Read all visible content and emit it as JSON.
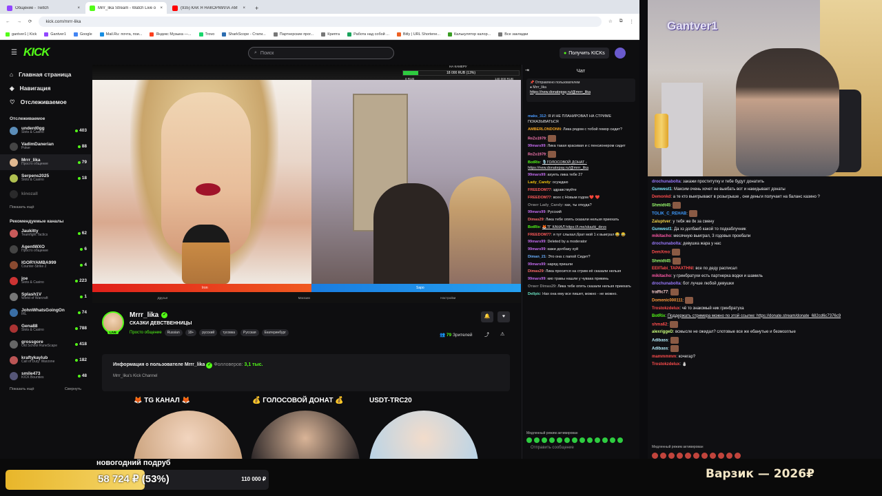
{
  "tabs": [
    {
      "title": "Общение - Twitch",
      "color": "#9146ff"
    },
    {
      "title": "Mrrr_lika Stream - Watch Live o",
      "color": "#53fc18"
    },
    {
      "title": "(935) КАК Я НАКОРМИЛА АМ",
      "color": "#ff0000"
    }
  ],
  "url": "kick.com/mrrr-lika",
  "bookmarks": [
    {
      "label": "gantver1 | Kick",
      "color": "#53fc18"
    },
    {
      "label": "Gantver1",
      "color": "#9146ff"
    },
    {
      "label": "Google",
      "color": "#4285f4"
    },
    {
      "label": "Mail.Ru: почта, пои...",
      "color": "#168de2"
    },
    {
      "label": "Яндекс Музыка —...",
      "color": "#fc3f1d"
    },
    {
      "label": "Trovo",
      "color": "#19d66b"
    },
    {
      "label": "SharkScope - Стати...",
      "color": "#2b6cb0"
    },
    {
      "label": "Партнерские прог...",
      "color": "#777"
    },
    {
      "label": "Крипта",
      "color": "#777"
    },
    {
      "label": "Работа над собой ...",
      "color": "#19a35b"
    },
    {
      "label": "Bitly | URL Shortene...",
      "color": "#ee6123"
    },
    {
      "label": "Калькулятор калор...",
      "color": "#3a9d23"
    },
    {
      "label": "Все закладки",
      "color": "#777"
    }
  ],
  "kick": {
    "logo": "KICK",
    "search_placeholder": "Поиск",
    "get_kicks": "Получить KICKs"
  },
  "sidebar": {
    "nav": [
      {
        "label": "Главная страница",
        "icon": "home-icon"
      },
      {
        "label": "Навигация",
        "icon": "compass-icon"
      },
      {
        "label": "Отслеживаемое",
        "icon": "heart-icon"
      }
    ],
    "followed_title": "Отслеживаемое",
    "followed": [
      {
        "name": "underd0gg",
        "cat": "Slots & Casino",
        "viewers": "403",
        "color": "#5b8db8"
      },
      {
        "name": "VadimDanerian",
        "cat": "Poker",
        "viewers": "88",
        "color": "#444"
      },
      {
        "name": "Mrrr_lika",
        "cat": "Просто общение",
        "viewers": "79",
        "color": "#e0b890"
      },
      {
        "name": "Serpens2025",
        "cat": "Slots & Casino",
        "viewers": "18",
        "color": "#b0c050"
      },
      {
        "name": "kinozall",
        "cat": "",
        "viewers": "",
        "color": "#555"
      }
    ],
    "show_more": "Показать ещё",
    "recommended_title": "Рекомендуемые каналы",
    "recommended": [
      {
        "name": "Jaukitty",
        "cat": "Teamfight Tactics",
        "viewers": "62",
        "color": "#c85a5a"
      },
      {
        "name": "AgentWXO",
        "cat": "Просто общение",
        "viewers": "6",
        "color": "#444"
      },
      {
        "name": "IGORYAMBA999",
        "cat": "Counter-Strike 2",
        "viewers": "4",
        "color": "#8a4a30"
      },
      {
        "name": "joe",
        "cat": "Slots & Casino",
        "viewers": "223",
        "color": "#c33"
      },
      {
        "name": "Splash1V",
        "cat": "World of Warcraft",
        "viewers": "1",
        "color": "#777"
      },
      {
        "name": "JohnWhatsGoingOn",
        "cat": "IRL",
        "viewers": "74",
        "color": "#3a6ea5"
      },
      {
        "name": "Gena88",
        "cat": "Slots & Casino",
        "viewers": "788",
        "color": "#a33"
      },
      {
        "name": "grossgore",
        "cat": "Old School RuneScape",
        "viewers": "418",
        "color": "#666"
      },
      {
        "name": "kraftykaylub",
        "cat": "Call of Duty: Warzone",
        "viewers": "182",
        "color": "#b55"
      },
      {
        "name": "smile473",
        "cat": "KICK Bounties",
        "viewers": "48",
        "color": "#557"
      }
    ],
    "show_more2": "Показать ещё",
    "collapse": "Свернуть"
  },
  "player": {
    "overlay_label": "НА КАМЕРУ",
    "progress_text": "18 000 RUB (13%)",
    "progress_pct": 13,
    "left_amt": "0 RUB",
    "right_amt": "140 000 RUB",
    "red_label": "Iron",
    "blue_label": "Sapo",
    "bottom": [
      "Друзья",
      "Магазин",
      "Настройки"
    ]
  },
  "stream": {
    "name": "Mrrr_lika",
    "title": "СКАЗКИ ДЕВСТВЕННИЦЫ",
    "category": "Просто общение",
    "tags": [
      "Russian",
      "18+",
      "русский",
      "тусовка",
      "Русская",
      "Екатеринбург"
    ],
    "viewers": "79",
    "viewers_label": "Зрителей",
    "live": "LIVE",
    "about_title": "Информация о пользователе Mrrr_lika",
    "followers_label": "Фолловеров:",
    "followers": "3,1 тыс.",
    "about_sub": "Mrrr_lika's Kick Channel",
    "panels": [
      "🦊 TG КАНАЛ 🦊",
      "💰 ГОЛОСОВОЙ ДОНАТ 💰",
      "USDT-TRC20"
    ]
  },
  "chat": {
    "title": "Чат",
    "pinned_label": "Отправлено пользователем",
    "pinned_user": "Mrrr_lika",
    "pinned_link": "https://new.donatepay.ru/@mrrr_lika",
    "messages": [
      {
        "user": "maks_312",
        "color": "#4a9bff",
        "text": "Я И НЕ ПЛАНИРОВАЛ НА СТРИМЕ ПОКАЗЫВАТЬСЯ"
      },
      {
        "user": "AMBERLONDONN",
        "color": "#f5a623",
        "text": "Лика рядом с тобой гемор сидит?"
      },
      {
        "user": "ReZo1979",
        "color": "#ff7ab6",
        "text": ""
      },
      {
        "user": "99mars99",
        "color": "#c56cf0",
        "text": "Лика такая красивая и с пенсионером сидит"
      },
      {
        "user": "ReZo1979",
        "color": "#ff7ab6",
        "text": ""
      },
      {
        "user": "BotRix",
        "color": "#53fc18",
        "text": "🎙️ГОЛОСОВОЙ ДОНАТ - https://new.donatepay.ru/@mrrr_lika"
      },
      {
        "user": "99mars99",
        "color": "#c56cf0",
        "text": "ахуеть лика тебе 27"
      },
      {
        "user": "Lady_Candy",
        "color": "#f1c40f",
        "text": "осуждаю"
      },
      {
        "user": "FREEDOM77",
        "color": "#ff5a5a",
        "text": "здравствуйте"
      },
      {
        "user": "FREEDOM77",
        "color": "#ff5a5a",
        "text": "всех с Новым годом ❤️ ❤️"
      },
      {
        "user": "Ответ Lady_Candy",
        "color": "#888",
        "text": "хах, ты откуда?"
      },
      {
        "user": "99mars99",
        "color": "#c56cf0",
        "text": "Русский"
      },
      {
        "user": "Dimas29",
        "color": "#ff6b6b",
        "text": "Лика тебе опять сказали нельзя приехать"
      },
      {
        "user": "BotRix",
        "color": "#53fc18",
        "text": "🦊ТГ КАНАЛ https://t.me/skazki_devs"
      },
      {
        "user": "FREEDOM77",
        "color": "#ff5a5a",
        "text": "я тут слыхал,брат мой 1 к выиграл 😂 😂"
      },
      {
        "user": "99mars99",
        "color": "#c56cf0",
        "text": "Deleted by a moderator"
      },
      {
        "user": "99mars99",
        "color": "#c56cf0",
        "text": "кажи долбаку хуй"
      },
      {
        "user": "Diman_21",
        "color": "#6ab0ff",
        "text": "Это она с папой Сидит?"
      },
      {
        "user": "99mars99",
        "color": "#c56cf0",
        "text": "наряд пришли"
      },
      {
        "user": "Dimas29",
        "color": "#ff6b6b",
        "text": "Лика просится на стрим её сказали нельзя"
      },
      {
        "user": "99mars99",
        "color": "#c56cf0",
        "text": "кио травы нашли у чувака прикинь"
      },
      {
        "user": "Ответ Dimas29",
        "color": "#888",
        "text": "Лика тебе опять сказали нельзя приехать"
      },
      {
        "user": "Dellpic",
        "color": "#6ae0c0",
        "text": "Нах она ему все пишет, можно - не можно."
      }
    ],
    "slow_mode": "Медленный режим активирован",
    "input_placeholder": "Отправить сообщение"
  },
  "webcam": {
    "title": "Gantver1"
  },
  "twitch": {
    "messages": [
      {
        "user": "drochunabolta",
        "color": "#9b7bff",
        "text": "закажи проститутку и тебе будут донатить"
      },
      {
        "user": "Gunwest1",
        "color": "#7ce8ff",
        "text": "Максим очень хочет ее выебать вот и накидывает донаты"
      },
      {
        "user": "Demonkd",
        "color": "#ff4d4d",
        "text": "а те кто выигрывают в розыгрыше , они деньги получает на баланс казино ?"
      },
      {
        "user": "Shmidt45",
        "color": "#9bff6e",
        "text": ""
      },
      {
        "user": "TOLIK_C_REHAB",
        "color": "#3f9cff",
        "text": ""
      },
      {
        "user": "Zaluptver",
        "color": "#f5d74a",
        "text": "у тебя же 8к за смену"
      },
      {
        "user": "Gunwest1",
        "color": "#7ce8ff",
        "text": "Да хз долбаеб какой то подкаблучник"
      },
      {
        "user": "mikitacho",
        "color": "#ff5aa8",
        "text": "месячную выиграл, 3 годовых проебали"
      },
      {
        "user": "drochunabolta",
        "color": "#9b7bff",
        "text": "девушка жара у нас"
      },
      {
        "user": "DemXmo",
        "color": "#ff4d4d",
        "text": ""
      },
      {
        "user": "Shmidt45",
        "color": "#9bff6e",
        "text": ""
      },
      {
        "user": "EEIITabi_TAPAXTHNI",
        "color": "#ff4d4d",
        "text": "все по деду расписал"
      },
      {
        "user": "mikitacho",
        "color": "#ff5aa8",
        "text": "у гринбратухи есть партнерка водки и шамиль"
      },
      {
        "user": "drochunabolta",
        "color": "#9b7bff",
        "text": "бот лучше любой девушки"
      },
      {
        "user": "traffic77",
        "color": "#ffd2d2",
        "text": ""
      },
      {
        "user": "Domenic000111",
        "color": "#ff9b3d",
        "text": ""
      },
      {
        "user": "Trostokzdelux",
        "color": "#ff4d4d",
        "text": "чё то знакомый ник гринбратуха"
      },
      {
        "user": "BotRix",
        "color": "#53fc18",
        "text": "Поддержать стримера можно по этой ссылке: https://donate.stream/donate_682cd6c7376c9"
      },
      {
        "user": "shma62",
        "color": "#ff4d4d",
        "text": ""
      },
      {
        "user": "alexriggeD",
        "color": "#c9ff7a",
        "text": "всмысле не ожидал? слотовые все же ебанутые и безмозглые"
      },
      {
        "user": "Adibass",
        "color": "#b8f1ff",
        "text": ""
      },
      {
        "user": "Adibass",
        "color": "#b8f1ff",
        "text": ""
      },
      {
        "user": "mammmmm",
        "color": "#ff4d4d",
        "text": "кочегар?"
      },
      {
        "user": "Trostokzdelux",
        "color": "#ff4d4d",
        "text": "⛄"
      }
    ],
    "slow_mode": "Медленный режим активирован"
  },
  "goal": {
    "title": "новогодний подруб",
    "amount": "58 724 ₽ (53%)",
    "pct": 53,
    "target": "110 000 ₽",
    "varzik": "Варзик — 2026₽"
  },
  "colors": {
    "kick_green": "#53fc18",
    "goal_gold": "#e8b62a"
  }
}
